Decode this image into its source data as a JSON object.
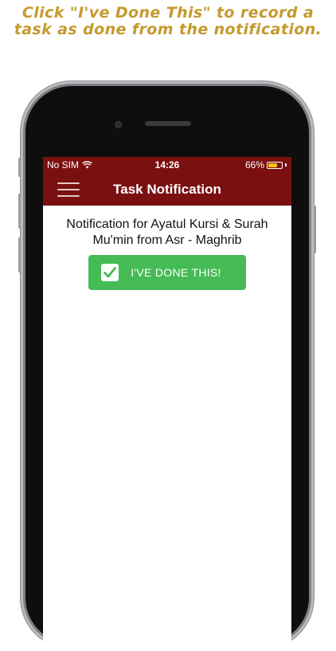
{
  "caption": {
    "line1": "Click \"I've Done This\" to record a",
    "line2": "task as done from the notification."
  },
  "status_bar": {
    "carrier": "No SIM",
    "time": "14:26",
    "battery_percent": "66%",
    "battery_level": 0.66,
    "battery_color": "#f5c11a"
  },
  "nav": {
    "title": "Task Notification",
    "background": "#7b1010",
    "menu_icon": "hamburger-menu-icon"
  },
  "notification": {
    "text": "Notification for Ayatul Kursi & Surah Mu'min from Asr - Maghrib"
  },
  "done_button": {
    "label": "I'VE DONE THIS!",
    "color": "#45bb56",
    "icon": "checkbox-check-icon"
  }
}
